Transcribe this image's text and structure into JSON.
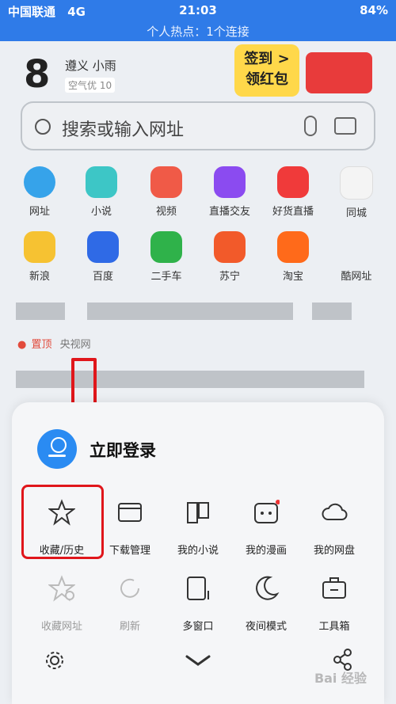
{
  "status_bar": {
    "carrier": "中国联通",
    "network": "4G",
    "time": "21:03",
    "battery": "84%"
  },
  "hotspot_banner": "个人热点：1个连接",
  "weather": {
    "temp": "8",
    "location": "遵义 小雨",
    "air_quality": "空气优 10"
  },
  "promo": {
    "line1": "签到 >",
    "line2": "领红包"
  },
  "search": {
    "placeholder": "搜索或输入网址"
  },
  "apps_row1": [
    "网址",
    "小说",
    "视频",
    "直播交友",
    "好货直播",
    "同城"
  ],
  "apps_row2": [
    "新浪",
    "百度",
    "二手车",
    "苏宁",
    "淘宝",
    "酷网址"
  ],
  "pinned": {
    "tag": "置顶",
    "source": "央视网"
  },
  "menu": {
    "login_label": "立即登录",
    "row1": [
      "收藏/历史",
      "下载管理",
      "我的小说",
      "我的漫画",
      "我的网盘"
    ],
    "row2": [
      "收藏网址",
      "刷新",
      "多窗口",
      "夜间模式",
      "工具箱"
    ]
  },
  "watermark": "Bai 经验",
  "colors": {
    "primary": "#2f7be8",
    "highlight": "#e0161b",
    "avatar": "#2a8bf2"
  }
}
